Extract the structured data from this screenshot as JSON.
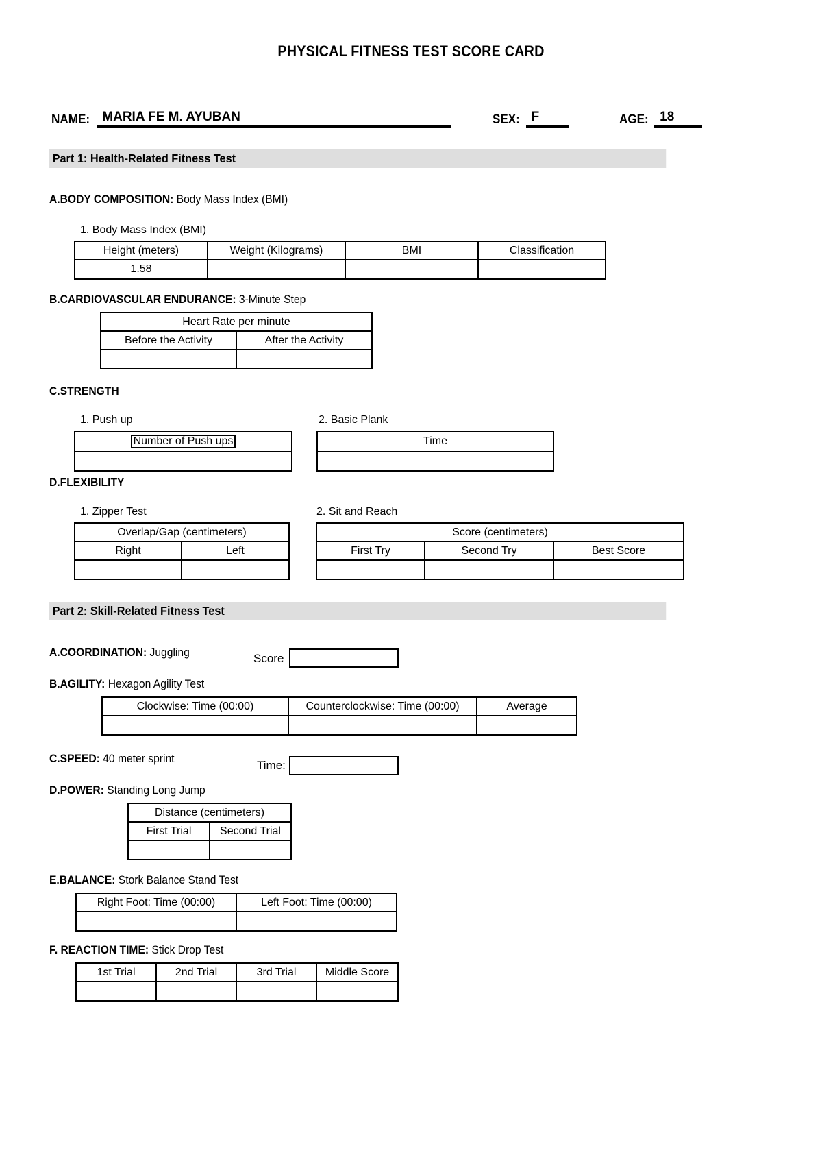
{
  "document": {
    "title": "PHYSICAL FITNESS TEST SCORE CARD"
  },
  "identity": {
    "name_label": "NAME:",
    "name_value": "MARIA FE M. AYUBAN",
    "sex_label": "SEX:",
    "sex_value": "F",
    "age_label": "AGE:",
    "age_value": "18"
  },
  "part1": {
    "banner": "Part 1: Health-Related Fitness Test",
    "body_composition": {
      "heading_bold": "A.BODY COMPOSITION:",
      "heading_rest": " Body Mass Index (BMI)",
      "sub_label": "1. Body Mass Index (BMI)",
      "columns": [
        "Height (meters)",
        "Weight (Kilograms)",
        "BMI",
        "Classification"
      ],
      "values": [
        "1.58",
        "",
        "",
        ""
      ]
    },
    "cardiovascular": {
      "heading_bold": "B.CARDIOVASCULAR ENDURANCE:",
      "heading_rest": " 3-Minute Step",
      "group_header": "Heart Rate per minute",
      "columns": [
        "Before the Activity",
        "After the Activity"
      ],
      "values": [
        "",
        ""
      ]
    },
    "strength": {
      "heading_bold": "C.STRENGTH",
      "push_up": {
        "sub_label": "1. Push up",
        "header": "Number of Push ups",
        "value": ""
      },
      "basic_plank": {
        "sub_label": "2. Basic Plank",
        "header": "Time",
        "value": ""
      }
    },
    "flexibility": {
      "heading_bold": "D.FLEXIBILITY",
      "zipper_test": {
        "sub_label": "1. Zipper Test",
        "group_header": "Overlap/Gap (centimeters)",
        "columns": [
          "Right",
          "Left"
        ],
        "values": [
          "",
          ""
        ]
      },
      "sit_and_reach": {
        "sub_label": "2. Sit and Reach",
        "group_header": "Score (centimeters)",
        "columns": [
          "First Try",
          "Second Try",
          "Best Score"
        ],
        "values": [
          "",
          "",
          ""
        ]
      }
    }
  },
  "part2": {
    "banner": "Part 2: Skill-Related Fitness Test",
    "coordination": {
      "heading_bold": "A.COORDINATION:",
      "heading_rest": " Juggling",
      "field_label": "Score",
      "field_value": ""
    },
    "agility": {
      "heading_bold": "B.AGILITY:",
      "heading_rest": " Hexagon Agility Test",
      "columns": [
        "Clockwise: Time (00:00)",
        "Counterclockwise: Time (00:00)",
        "Average"
      ],
      "values": [
        "",
        "",
        ""
      ]
    },
    "speed": {
      "heading_bold": "C.SPEED:",
      "heading_rest": " 40 meter sprint",
      "field_label": "Time:",
      "field_value": ""
    },
    "power": {
      "heading_bold": "D.POWER:",
      "heading_rest": " Standing Long Jump",
      "group_header": "Distance (centimeters)",
      "columns": [
        "First Trial",
        "Second Trial"
      ],
      "values": [
        "",
        ""
      ]
    },
    "balance": {
      "heading_bold": "E.BALANCE:",
      "heading_rest": " Stork Balance Stand Test",
      "columns": [
        "Right Foot: Time (00:00)",
        "Left Foot: Time (00:00)"
      ],
      "values": [
        "",
        ""
      ]
    },
    "reaction_time": {
      "heading_bold": "F. REACTION TIME:",
      "heading_rest": " Stick Drop Test",
      "columns": [
        "1st Trial",
        "2nd Trial",
        "3rd Trial",
        "Middle Score"
      ],
      "values": [
        "",
        "",
        "",
        ""
      ]
    }
  }
}
